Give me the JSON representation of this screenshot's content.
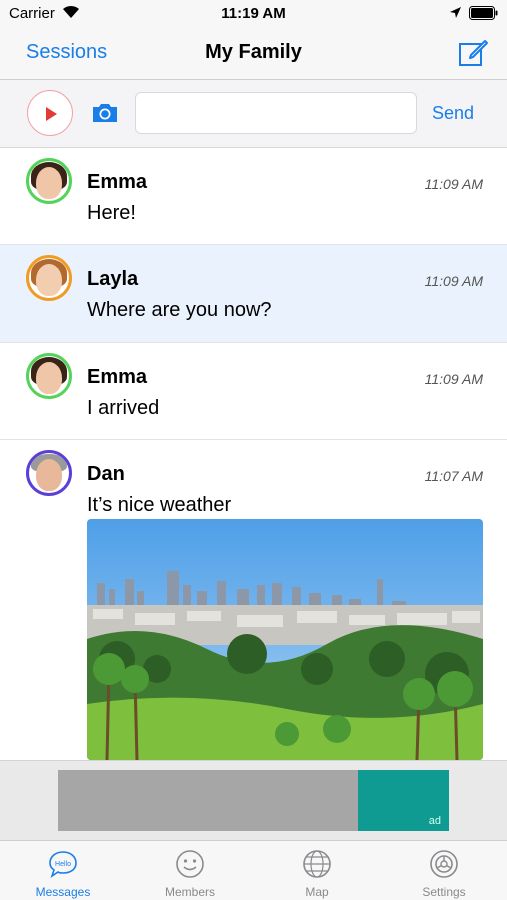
{
  "status_bar": {
    "carrier": "Carrier",
    "time": "11:19 AM"
  },
  "nav": {
    "back_label": "Sessions",
    "title": "My Family"
  },
  "composer": {
    "input_value": "",
    "send_label": "Send"
  },
  "messages": [
    {
      "name": "Emma",
      "time": "11:09 AM",
      "text": "Here!"
    },
    {
      "name": "Layla",
      "time": "11:09 AM",
      "text": "Where are you now?"
    },
    {
      "name": "Emma",
      "time": "11:09 AM",
      "text": "I arrived"
    },
    {
      "name": "Dan",
      "time": "11:07 AM",
      "text": "It’s nice weather"
    }
  ],
  "ad": {
    "label": "ad"
  },
  "tabs": [
    {
      "label": "Messages",
      "icon": "hello-bubble-icon",
      "active": true
    },
    {
      "label": "Members",
      "icon": "smiley-icon",
      "active": false
    },
    {
      "label": "Map",
      "icon": "globe-icon",
      "active": false
    },
    {
      "label": "Settings",
      "icon": "gear-icon",
      "active": false
    }
  ],
  "colors": {
    "accent": "#1a7ee8",
    "highlight_row": "#eaf3fd",
    "avatar_ring_green": "#54d35a",
    "avatar_ring_orange": "#f29b24",
    "avatar_ring_purple": "#5b3fd6",
    "ad_teal": "#0f9a92"
  }
}
